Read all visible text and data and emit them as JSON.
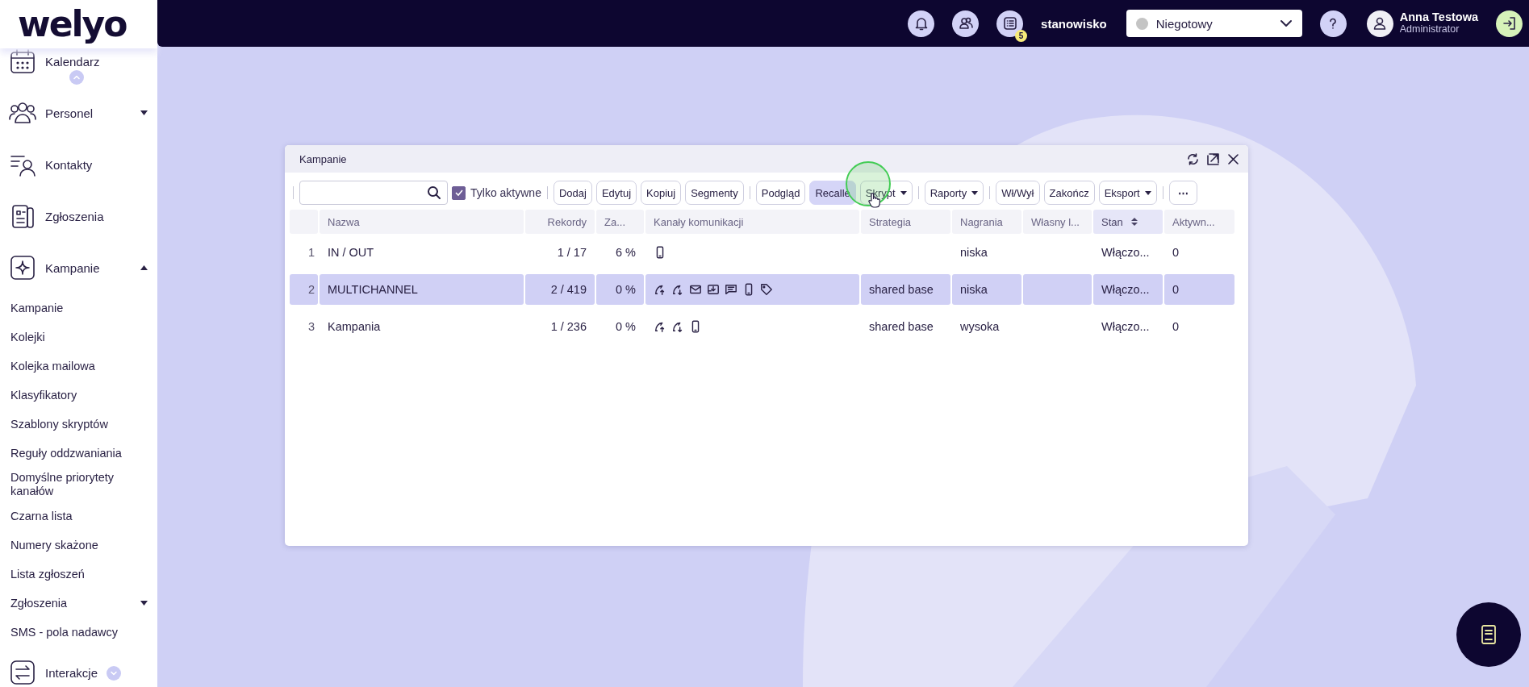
{
  "logo": {
    "text": "welyo"
  },
  "sidebar": {
    "items": [
      {
        "kind": "main",
        "label": "Kalendarz"
      },
      {
        "kind": "main",
        "label": "Personel",
        "expanded": false
      },
      {
        "kind": "main",
        "label": "Kontakty"
      },
      {
        "kind": "main",
        "label": "Zgłoszenia"
      },
      {
        "kind": "main",
        "label": "Kampanie",
        "expanded": true
      },
      {
        "kind": "sub",
        "label": "Kampanie"
      },
      {
        "kind": "sub",
        "label": "Kolejki"
      },
      {
        "kind": "sub",
        "label": "Kolejka mailowa"
      },
      {
        "kind": "sub",
        "label": "Klasyfikatory"
      },
      {
        "kind": "sub",
        "label": "Szablony skryptów"
      },
      {
        "kind": "sub",
        "label": "Reguły oddzwaniania"
      },
      {
        "kind": "sub",
        "label": "Domyślne priorytety kanałów"
      },
      {
        "kind": "sub",
        "label": "Czarna lista"
      },
      {
        "kind": "sub",
        "label": "Numery skażone"
      },
      {
        "kind": "sub",
        "label": "Lista zgłoszeń"
      },
      {
        "kind": "sub",
        "label": "Zgłoszenia",
        "expanded": false
      },
      {
        "kind": "sub",
        "label": "SMS - pola nadawcy"
      },
      {
        "kind": "main",
        "label": "Interakcje"
      }
    ]
  },
  "topbar": {
    "notifications_badge": "5",
    "workstation": "stanowisko",
    "status": {
      "value": "Niegotowy",
      "color": "#c4c4c4"
    },
    "user": {
      "name": "Anna Testowa",
      "role": "Administrator"
    }
  },
  "window": {
    "title": "Kampanie",
    "toolbar": {
      "only_active": {
        "label": "Tylko aktywne",
        "checked": true
      },
      "groups": [
        [
          {
            "label": "Dodaj",
            "highlighted": false,
            "dropdown": false
          },
          {
            "label": "Edytuj",
            "highlighted": false,
            "dropdown": false
          },
          {
            "label": "Kopiuj",
            "highlighted": false,
            "dropdown": false
          },
          {
            "label": "Segmenty",
            "highlighted": false,
            "dropdown": false
          }
        ],
        [
          {
            "label": "Podgląd",
            "highlighted": false,
            "dropdown": false
          },
          {
            "label": "Recalle",
            "highlighted": true,
            "dropdown": false
          },
          {
            "label": "Skrypt",
            "highlighted": false,
            "dropdown": true
          }
        ],
        [
          {
            "label": "Raporty",
            "highlighted": false,
            "dropdown": true
          }
        ],
        [
          {
            "label": "Wł/Wył",
            "highlighted": false,
            "dropdown": false
          },
          {
            "label": "Zakończ",
            "highlighted": false,
            "dropdown": false
          },
          {
            "label": "Eksport",
            "highlighted": false,
            "dropdown": true
          }
        ],
        [
          {
            "label": "⋯",
            "highlighted": false,
            "dropdown": false
          }
        ]
      ]
    },
    "table": {
      "columns": [
        {
          "label": "Nazwa",
          "sorted": false
        },
        {
          "label": "Rekordy",
          "sorted": false
        },
        {
          "label": "Za...",
          "sorted": false
        },
        {
          "label": "Kanały komunikacji",
          "sorted": false
        },
        {
          "label": "Strategia",
          "sorted": false
        },
        {
          "label": "Nagrania",
          "sorted": false
        },
        {
          "label": "Własny l...",
          "sorted": false
        },
        {
          "label": "Stan",
          "sorted": true
        },
        {
          "label": "Aktywn...",
          "sorted": false
        }
      ],
      "rows": [
        {
          "number": "1",
          "name": "IN / OUT",
          "records": "1 / 17",
          "za": "6 %",
          "channels": [
            {
              "kind": "mobile"
            }
          ],
          "recordings": "niska",
          "state": "Włączo...",
          "active": "0",
          "selected": false
        },
        {
          "number": "2",
          "name": "MULTICHANNEL",
          "records": "2 / 419",
          "za": "0 %",
          "channels": [
            {
              "kind": "call-out"
            },
            {
              "kind": "call-in"
            },
            {
              "kind": "email"
            },
            {
              "kind": "inbox"
            },
            {
              "kind": "chat"
            },
            {
              "kind": "mobile"
            },
            {
              "kind": "tag"
            }
          ],
          "strategy": "shared base",
          "recordings": "niska",
          "state": "Włączo...",
          "active": "0",
          "selected": true
        },
        {
          "number": "3",
          "name": "Kampania",
          "records": "1 / 236",
          "za": "0 %",
          "channels": [
            {
              "kind": "call-out"
            },
            {
              "kind": "call-in"
            },
            {
              "kind": "mobile"
            }
          ],
          "strategy": "shared base",
          "recordings": "wysoka",
          "state": "Włączo...",
          "active": "0",
          "selected": false
        }
      ]
    }
  }
}
